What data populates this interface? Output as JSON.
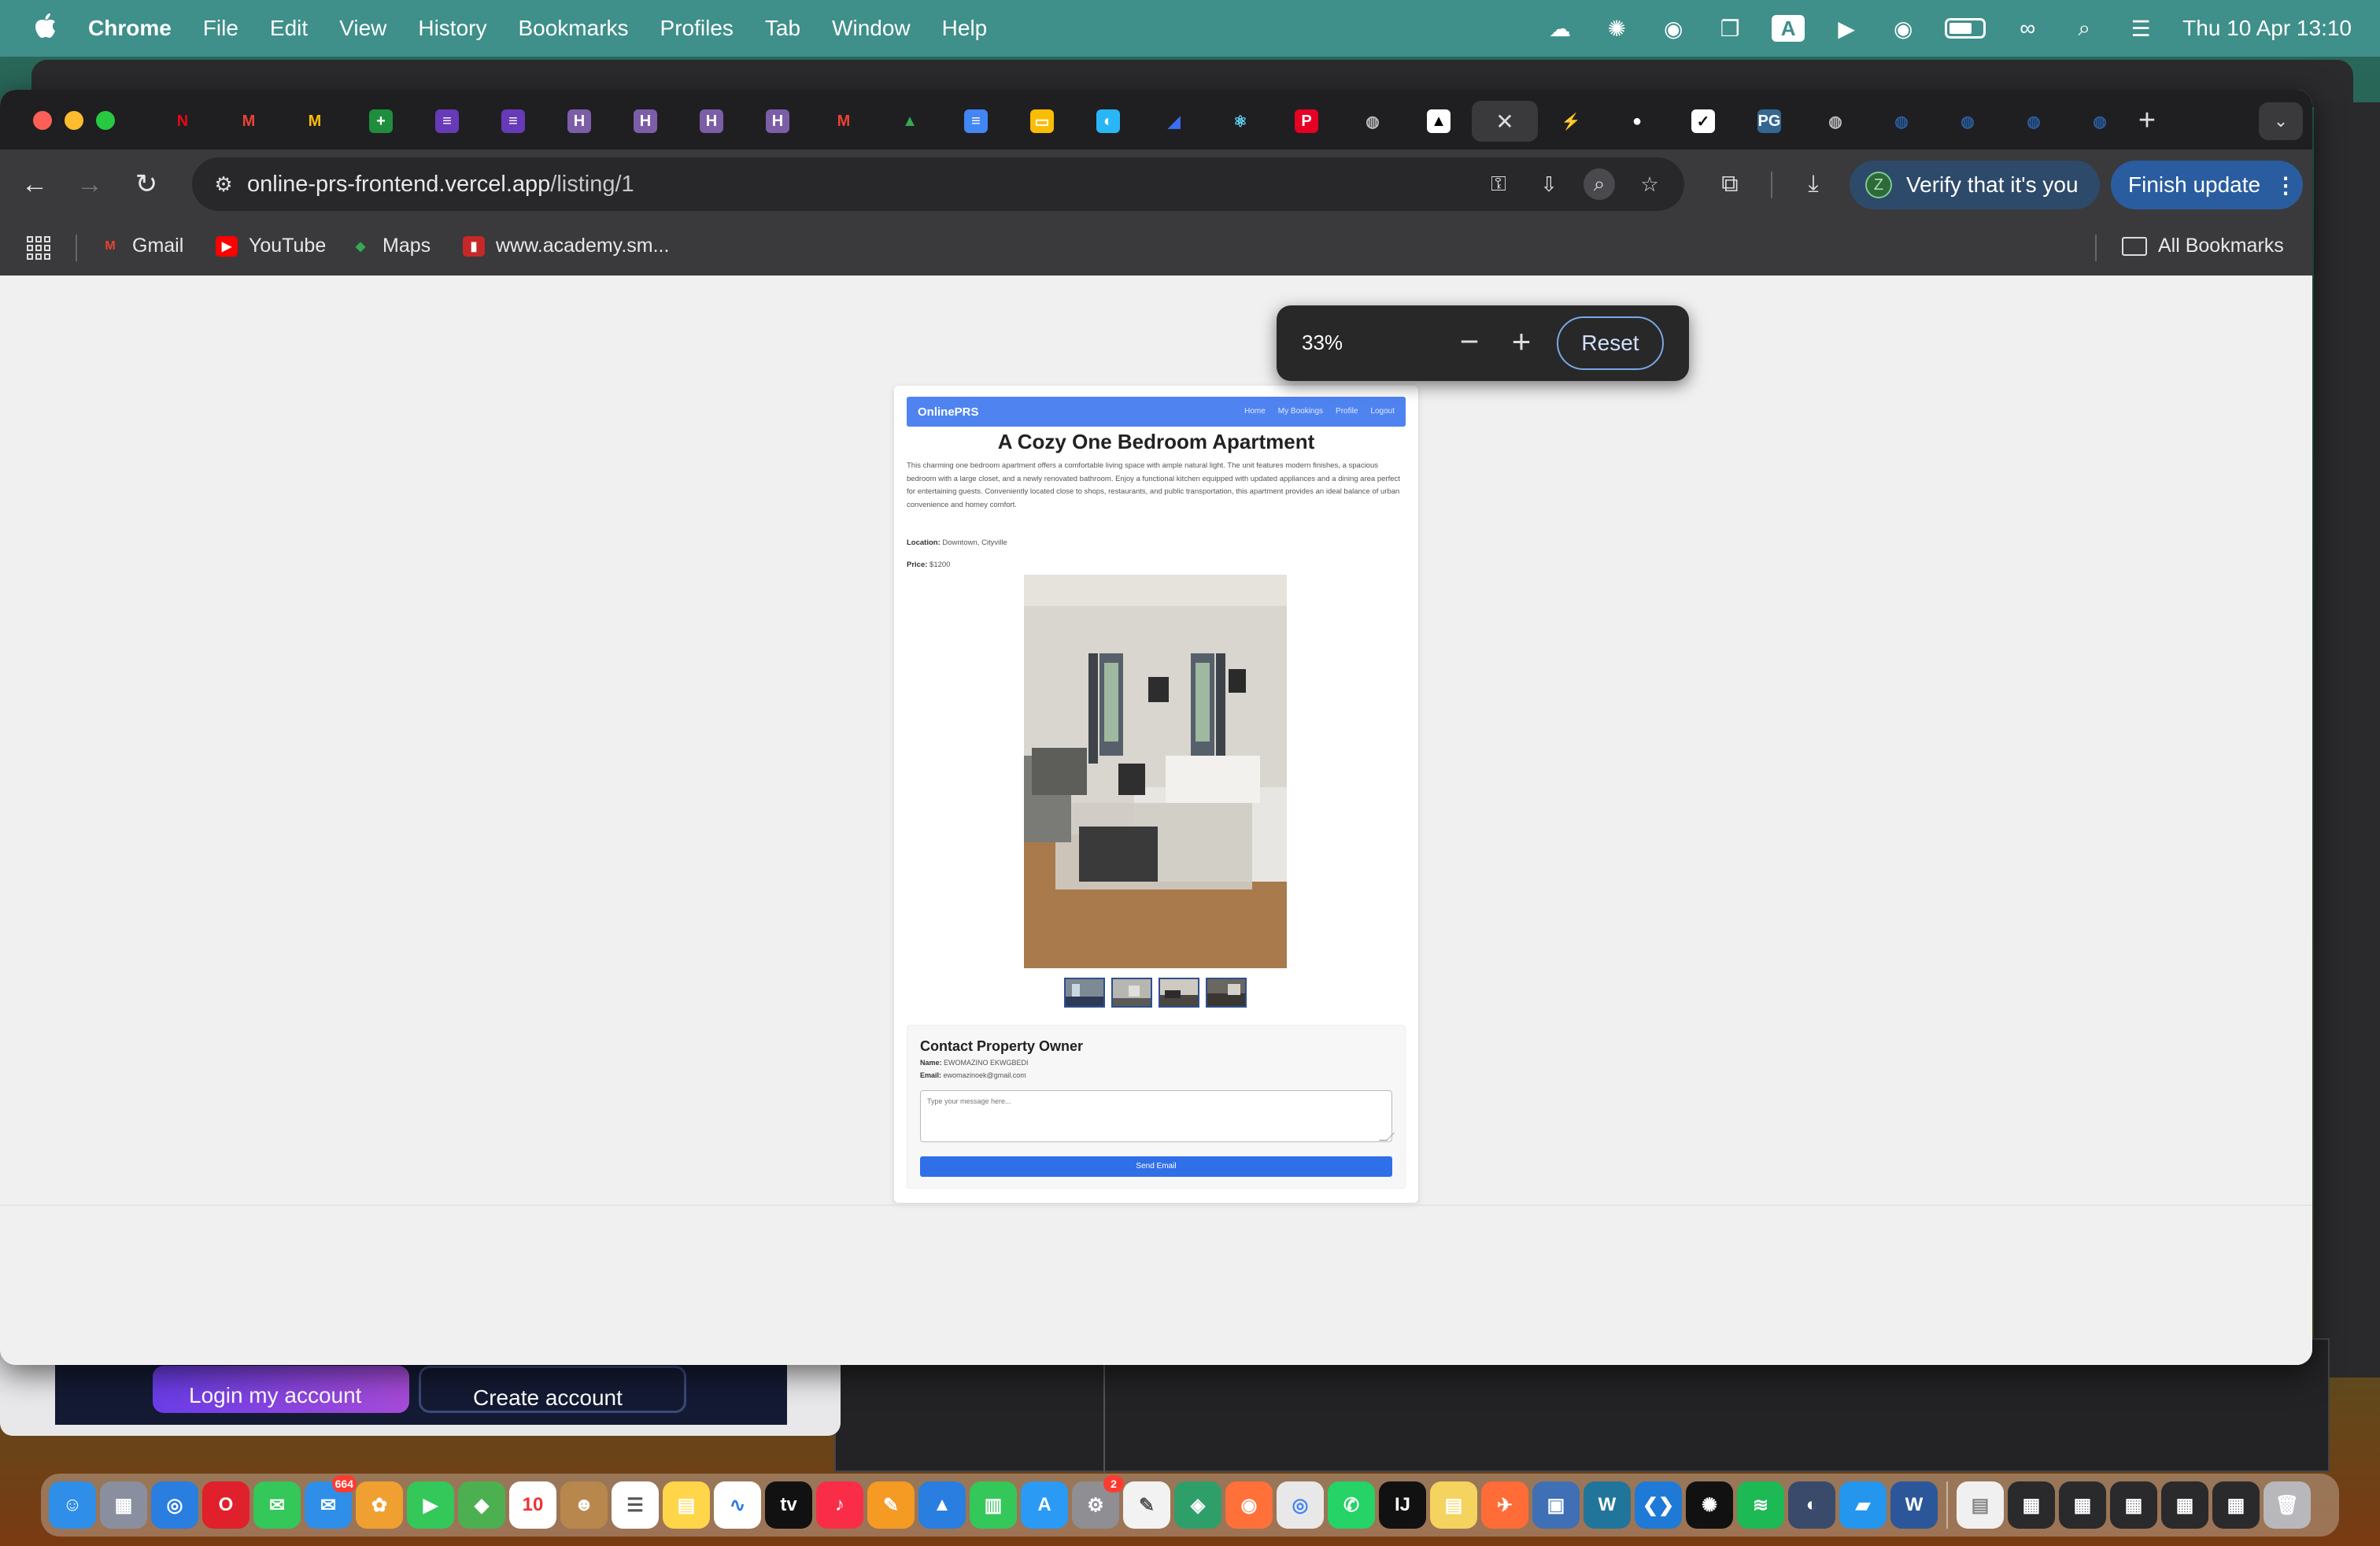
{
  "menubar": {
    "app": "Chrome",
    "items": [
      "File",
      "Edit",
      "View",
      "History",
      "Bookmarks",
      "Profiles",
      "Tab",
      "Window",
      "Help"
    ],
    "keyboard_indicator": "A",
    "clock": "Thu 10 Apr  13:10"
  },
  "tabs": {
    "favicons": [
      {
        "name": "netflix-favicon",
        "glyph": "N",
        "bg": "#1f1f21",
        "fg": "#e50914"
      },
      {
        "name": "gmail-favicon",
        "glyph": "M",
        "bg": "#1f1f21",
        "fg": "#ea4335"
      },
      {
        "name": "gmail-favicon",
        "glyph": "M",
        "bg": "#1f1f21",
        "fg": "#fbbc04"
      },
      {
        "name": "sheets-favicon",
        "glyph": "+",
        "bg": "#1e8e3e",
        "fg": "#fff"
      },
      {
        "name": "forms-favicon",
        "glyph": "≡",
        "bg": "#673ab7",
        "fg": "#fff"
      },
      {
        "name": "forms-favicon",
        "glyph": "≡",
        "bg": "#673ab7",
        "fg": "#fff"
      },
      {
        "name": "hackerrank-favicon",
        "glyph": "H",
        "bg": "#7b5ea7",
        "fg": "#fff"
      },
      {
        "name": "hackerrank-favicon",
        "glyph": "H",
        "bg": "#7b5ea7",
        "fg": "#fff"
      },
      {
        "name": "hackerrank-favicon",
        "glyph": "H",
        "bg": "#7b5ea7",
        "fg": "#fff"
      },
      {
        "name": "hackerrank-favicon",
        "glyph": "H",
        "bg": "#7b5ea7",
        "fg": "#fff"
      },
      {
        "name": "gmail-favicon",
        "glyph": "M",
        "bg": "#1f1f21",
        "fg": "#ea4335"
      },
      {
        "name": "drive-favicon",
        "glyph": "▲",
        "bg": "#1f1f21",
        "fg": "#34a853"
      },
      {
        "name": "docs-favicon",
        "glyph": "≡",
        "bg": "#4285f4",
        "fg": "#fff"
      },
      {
        "name": "slides-favicon",
        "glyph": "▭",
        "bg": "#fbbc04",
        "fg": "#fff"
      },
      {
        "name": "app-favicon",
        "glyph": "◐",
        "bg": "#29b6f6",
        "fg": "#fff"
      },
      {
        "name": "brand-favicon",
        "glyph": "◢",
        "bg": "#1f1f21",
        "fg": "#3b6ef5"
      },
      {
        "name": "react-favicon",
        "glyph": "⚛",
        "bg": "#1f1f21",
        "fg": "#61dafb"
      },
      {
        "name": "pinterest-favicon",
        "glyph": "P",
        "bg": "#e60023",
        "fg": "#fff"
      },
      {
        "name": "globe-favicon",
        "glyph": "◍",
        "bg": "#1f1f21",
        "fg": "#bbb"
      },
      {
        "name": "vercel-favicon",
        "glyph": "▲",
        "bg": "#fff",
        "fg": "#000"
      }
    ],
    "favicons_after": [
      {
        "name": "bolt-favicon",
        "glyph": "⚡",
        "bg": "#1f1f21",
        "fg": "#3ecf8e"
      },
      {
        "name": "github-favicon",
        "glyph": "●",
        "bg": "#1f1f21",
        "fg": "#fff"
      },
      {
        "name": "extension-favicon",
        "glyph": "✓",
        "bg": "#fff",
        "fg": "#111"
      },
      {
        "name": "postgres-favicon",
        "glyph": "PG",
        "bg": "#336791",
        "fg": "#fff"
      },
      {
        "name": "globe-favicon",
        "glyph": "◍",
        "bg": "#1f1f21",
        "fg": "#bbb"
      },
      {
        "name": "app-favicon",
        "glyph": "◍",
        "bg": "#1f1f21",
        "fg": "#2a5d9f"
      },
      {
        "name": "app-favicon",
        "glyph": "◍",
        "bg": "#1f1f21",
        "fg": "#2a5d9f"
      },
      {
        "name": "app-favicon",
        "glyph": "◍",
        "bg": "#1f1f21",
        "fg": "#2a5d9f"
      },
      {
        "name": "app-favicon",
        "glyph": "◍",
        "bg": "#1f1f21",
        "fg": "#2a5d9f"
      }
    ]
  },
  "toolbar": {
    "url_host": "online-prs-frontend.vercel.app",
    "url_path": "/listing/1",
    "verify_label": "Verify that it's you",
    "verify_avatar": "Z",
    "finish_label": "Finish update"
  },
  "bookmarks": [
    {
      "label": "Gmail",
      "glyph": "M",
      "bg": "#3a3a3c",
      "fg": "#ea4335"
    },
    {
      "label": "YouTube",
      "glyph": "▶",
      "bg": "#ff0000",
      "fg": "#fff"
    },
    {
      "label": "Maps",
      "glyph": "◆",
      "bg": "#3a3a3c",
      "fg": "#34a853"
    },
    {
      "label": "www.academy.sm...",
      "glyph": "▮",
      "bg": "#c62828",
      "fg": "#fff"
    }
  ],
  "bookmarks_all": "All Bookmarks",
  "zoom": {
    "level": "33%",
    "reset_label": "Reset"
  },
  "page": {
    "brand": "OnlinePRS",
    "nav": [
      "Home",
      "My Bookings",
      "Profile",
      "Logout"
    ],
    "title": "A Cozy One Bedroom Apartment",
    "description": "This charming one bedroom apartment offers a comfortable living space with ample natural light. The unit features modern finishes, a spacious bedroom with a large closet, and a newly renovated bathroom. Enjoy a functional kitchen equipped with updated appliances and a dining area perfect for entertaining guests. Conveniently located close to shops, restaurants, and public transportation, this apartment provides an ideal balance of urban convenience and homey comfort.",
    "location_label": "Location:",
    "location": "Downtown, Cityville",
    "price_label": "Price:",
    "price": "$1200",
    "contact": {
      "heading": "Contact Property Owner",
      "name_label": "Name:",
      "name": "EWOMAZINO EKWGBEDI",
      "email_label": "Email:",
      "email": "ewomazinoek@gmail.com",
      "message_placeholder": "Type your message here...",
      "send_label": "Send Email"
    }
  },
  "background": {
    "login_label": "Login my account",
    "create_label": "Create account"
  },
  "dock": {
    "apps": [
      {
        "name": "finder-icon",
        "glyph": "☺",
        "bg": "#2f8fe8"
      },
      {
        "name": "launchpad-icon",
        "glyph": "▦",
        "bg": "#8a8fa0"
      },
      {
        "name": "safari-icon",
        "glyph": "◎",
        "bg": "#2a7ee0"
      },
      {
        "name": "opera-icon",
        "glyph": "O",
        "bg": "#e0202b"
      },
      {
        "name": "messages-icon",
        "glyph": "✉",
        "bg": "#34c759"
      },
      {
        "name": "mail-icon",
        "glyph": "✉",
        "bg": "#2f8fe8",
        "badge": "664"
      },
      {
        "name": "photos-icon",
        "glyph": "✿",
        "bg": "#f0a030"
      },
      {
        "name": "facetime-icon",
        "glyph": "▶",
        "bg": "#34c759"
      },
      {
        "name": "maps-icon",
        "glyph": "◆",
        "bg": "#4cb050"
      },
      {
        "name": "calendar-icon",
        "glyph": "10",
        "bg": "#ffffff",
        "fg": "#e33"
      },
      {
        "name": "contacts-icon",
        "glyph": "☻",
        "bg": "#b8874e"
      },
      {
        "name": "reminders-icon",
        "glyph": "☰",
        "bg": "#ffffff",
        "fg": "#555"
      },
      {
        "name": "notes-icon",
        "glyph": "▤",
        "bg": "#ffd54a"
      },
      {
        "name": "freeform-icon",
        "glyph": "∿",
        "bg": "#ffffff",
        "fg": "#2a7ee0"
      },
      {
        "name": "appletv-icon",
        "glyph": "tv",
        "bg": "#111111"
      },
      {
        "name": "music-icon",
        "glyph": "♪",
        "bg": "#fa2d48"
      },
      {
        "name": "pages-icon",
        "glyph": "✎",
        "bg": "#f59a23"
      },
      {
        "name": "keynote-icon",
        "glyph": "▲",
        "bg": "#2a7ee0"
      },
      {
        "name": "numbers-icon",
        "glyph": "▥",
        "bg": "#34c759"
      },
      {
        "name": "appstore-icon",
        "glyph": "A",
        "bg": "#2a9af5"
      },
      {
        "name": "settings-icon",
        "glyph": "⚙",
        "bg": "#8e8e93",
        "badge": "2"
      },
      {
        "name": "textedit-icon",
        "glyph": "✎",
        "bg": "#f2f2f2",
        "fg": "#555"
      },
      {
        "name": "stack-icon",
        "glyph": "◈",
        "bg": "#2f9f6a"
      },
      {
        "name": "firefox-icon",
        "glyph": "◉",
        "bg": "#ff7139"
      },
      {
        "name": "chrome-icon",
        "glyph": "◎",
        "bg": "#e8e8e8",
        "fg": "#4285f4"
      },
      {
        "name": "whatsapp-icon",
        "glyph": "✆",
        "bg": "#25d366"
      },
      {
        "name": "intellij-icon",
        "glyph": "IJ",
        "bg": "#111111"
      },
      {
        "name": "stickies-icon",
        "glyph": "▤",
        "bg": "#f4d35e"
      },
      {
        "name": "postman-icon",
        "glyph": "✈",
        "bg": "#ff6c37"
      },
      {
        "name": "preview-icon",
        "glyph": "▣",
        "bg": "#3f6fb5"
      },
      {
        "name": "wordpress-icon",
        "glyph": "W",
        "bg": "#21759b"
      },
      {
        "name": "vscode-icon",
        "glyph": "❮❯",
        "bg": "#1e7ad6"
      },
      {
        "name": "chatgpt-icon",
        "glyph": "✺",
        "bg": "#111111"
      },
      {
        "name": "spotify-icon",
        "glyph": "≋",
        "bg": "#1db954"
      },
      {
        "name": "tableplus-icon",
        "glyph": "◐",
        "bg": "#3a4a6a"
      },
      {
        "name": "docker-icon",
        "glyph": "▰",
        "bg": "#2496ed"
      },
      {
        "name": "word-icon",
        "glyph": "W",
        "bg": "#2b579a"
      }
    ],
    "recents": [
      {
        "name": "document-thumbnail",
        "glyph": "▤",
        "bg": "#f0f0f0",
        "fg": "#888"
      },
      {
        "name": "screenshot-thumbnail",
        "glyph": "▦",
        "bg": "#2a2a2c"
      },
      {
        "name": "screenshot-thumbnail",
        "glyph": "▦",
        "bg": "#2a2a2c"
      },
      {
        "name": "screenshot-thumbnail",
        "glyph": "▦",
        "bg": "#2a2a2c"
      },
      {
        "name": "screenshot-thumbnail",
        "glyph": "▦",
        "bg": "#2a2a2c"
      },
      {
        "name": "screenshot-thumbnail",
        "glyph": "▦",
        "bg": "#2a2a2c"
      },
      {
        "name": "trash-icon",
        "glyph": "🗑",
        "bg": "#b8b8bc"
      }
    ]
  }
}
